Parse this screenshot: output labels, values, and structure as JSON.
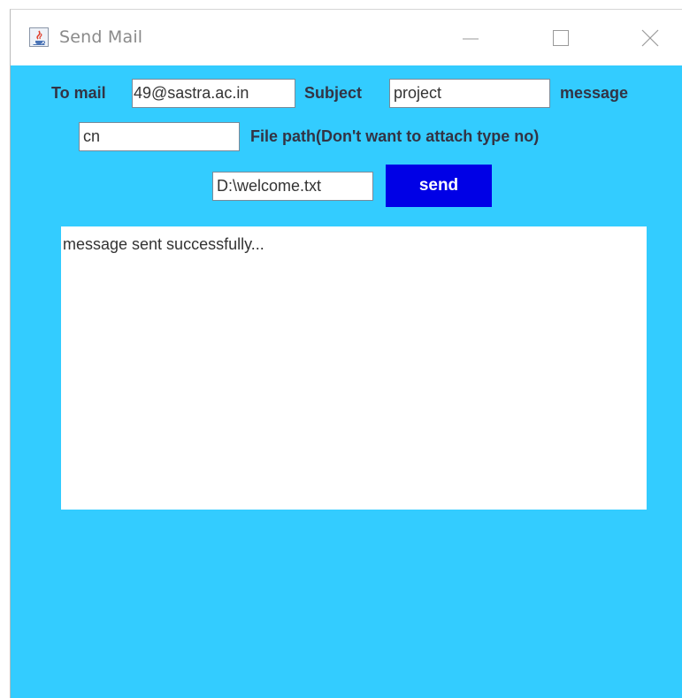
{
  "window": {
    "title": "Send Mail",
    "icon": "java-cup-icon",
    "controls": [
      "minimize-icon",
      "maximize-icon",
      "close-icon"
    ]
  },
  "form": {
    "to_label": "To mail",
    "to_value": "49@sastra.ac.in",
    "subject_label": "Subject",
    "subject_value": "project",
    "message_label": "message",
    "message_value": "cn",
    "filepath_label": "File path(Don't want to attach type no)",
    "filepath_value": "D:\\welcome.txt",
    "send_label": "send"
  },
  "output": {
    "text": "message sent successfully..."
  },
  "colors": {
    "panel_background": "#33ccff",
    "send_button": "#0000e6",
    "send_button_text": "#ffffff",
    "label_text": "#333344"
  }
}
